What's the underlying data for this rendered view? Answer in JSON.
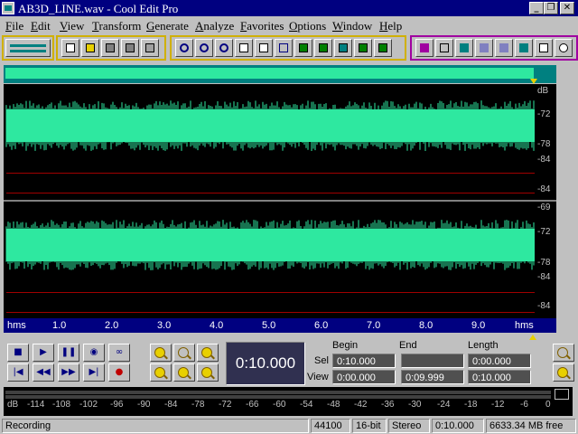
{
  "window": {
    "title": "AB3D_LINE.wav - Cool Edit Pro",
    "min_glyph": "_",
    "restore_glyph": "❐",
    "close_glyph": "✕"
  },
  "menu": [
    "File",
    "Edit",
    "View",
    "Transform",
    "Generate",
    "Analyze",
    "Favorites",
    "Options",
    "Window",
    "Help"
  ],
  "toolbar": {
    "group1": [
      "multitrack-view-icon"
    ],
    "group2": [
      "new-file-icon",
      "open-file-icon",
      "save-icon",
      "save-all-icon"
    ],
    "group3": [
      "undo-icon",
      "redo-icon",
      "repeat-icon",
      "copy-new-icon",
      "copy-icon",
      "cut-icon",
      "paste-icon",
      "paste-new-icon",
      "mix-paste-icon",
      "crop-icon",
      "trim-icon"
    ],
    "group4": [
      "envelope-icon",
      "filter-icon",
      "spectral-icon",
      "frequency-icon",
      "analysis-icon",
      "script-icon",
      "cue-icon",
      "info-icon"
    ]
  },
  "colors": {
    "waveform": "#2ee8a0",
    "background": "#000000",
    "ruler": "#000080",
    "overview": "#008080",
    "accent": "#e8d000"
  },
  "waveform": {
    "channel1_db_labels": [
      "dB",
      "-72",
      "-78",
      "-84",
      "-84"
    ],
    "channel2_db_labels": [
      "-69",
      "-72",
      "-78",
      "-84",
      "-84"
    ]
  },
  "ruler": {
    "unit_left": "hms",
    "unit_right": "hms",
    "ticks": [
      "1.0",
      "2.0",
      "3.0",
      "4.0",
      "5.0",
      "6.0",
      "7.0",
      "8.0",
      "9.0"
    ]
  },
  "transport": {
    "row1": [
      {
        "name": "stop-button",
        "glyph": "■"
      },
      {
        "name": "play-button",
        "glyph": "▶"
      },
      {
        "name": "pause-button",
        "glyph": "❚❚"
      },
      {
        "name": "play-to-end-button",
        "glyph": "◉"
      },
      {
        "name": "loop-button",
        "glyph": "∞"
      }
    ],
    "row2": [
      {
        "name": "go-to-start-button",
        "glyph": "|◀"
      },
      {
        "name": "rewind-button",
        "glyph": "◀◀"
      },
      {
        "name": "fast-forward-button",
        "glyph": "▶▶"
      },
      {
        "name": "go-to-end-button",
        "glyph": "▶|"
      },
      {
        "name": "record-button",
        "glyph": "●"
      }
    ]
  },
  "zoom": {
    "buttons": [
      "zoom-in-icon",
      "zoom-out-icon",
      "zoom-full-icon",
      "zoom-selection-icon",
      "zoom-left-icon",
      "zoom-right-icon"
    ]
  },
  "time_display": "0:10.000",
  "selection": {
    "header_begin": "Begin",
    "header_end": "End",
    "header_length": "Length",
    "sel_label": "Sel",
    "view_label": "View",
    "sel_begin": "0:10.000",
    "sel_end": "",
    "sel_length": "0:00.000",
    "view_begin": "0:00.000",
    "view_end": "0:09.999",
    "view_length": "0:10.000"
  },
  "meter": {
    "scale": [
      "dB",
      "-114",
      "-108",
      "-102",
      "-96",
      "-90",
      "-84",
      "-78",
      "-72",
      "-66",
      "-60",
      "-54",
      "-48",
      "-42",
      "-36",
      "-30",
      "-24",
      "-18",
      "-12",
      "-6",
      "0"
    ]
  },
  "status": {
    "state": "Recording",
    "sample_rate": "44100",
    "bit_depth": "16-bit",
    "channels": "Stereo",
    "duration": "0:10.000",
    "free_space": "6633.34 MB free"
  }
}
